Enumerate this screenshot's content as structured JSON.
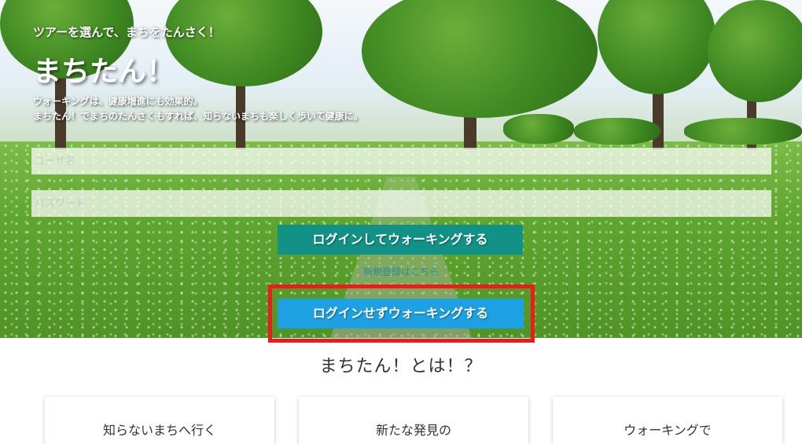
{
  "hero": {
    "tagline": "ツアーを選んで、まちをたんさく！",
    "title": "まちたん！",
    "desc_line1": "ウォーキングは、健康増進にも効果的。",
    "desc_line2": "まちたん！でまちのたんさくもすれば、知らないまちも楽しく歩いて健康に。"
  },
  "form": {
    "username_placeholder": "ユーザ名",
    "password_placeholder": "パスワード",
    "login_button": "ログインしてウォーキングする",
    "signup_link": "新規登録はこちら",
    "guest_button": "ログインせずウォーキングする"
  },
  "about": {
    "heading": "まちたん！とは！？",
    "cards": [
      {
        "title": "知らないまちへ行く"
      },
      {
        "title": "新たな発見の"
      },
      {
        "title": "ウォーキングで"
      }
    ]
  },
  "colors": {
    "login_button": "#129287",
    "guest_button": "#1ea1e2",
    "highlight_border": "#ee1b1b"
  }
}
